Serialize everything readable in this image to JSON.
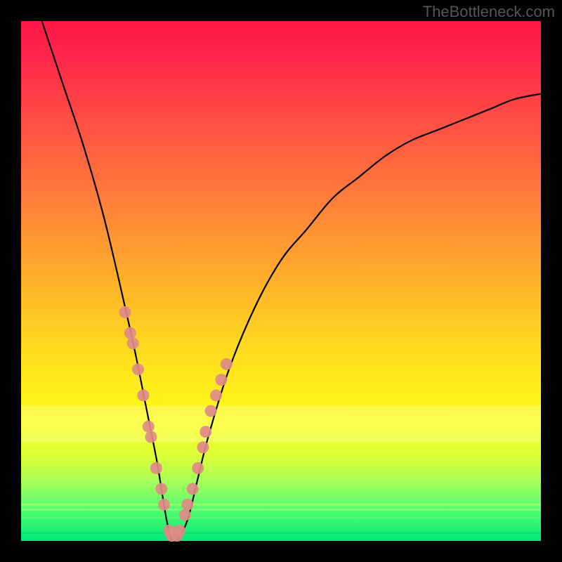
{
  "attribution": "TheBottleneck.com",
  "chart_data": {
    "type": "line",
    "title": "",
    "xlabel": "",
    "ylabel": "",
    "xlim": [
      0,
      100
    ],
    "ylim": [
      0,
      100
    ],
    "legend": false,
    "grid": false,
    "series": [
      {
        "name": "curve",
        "color": "#000000",
        "x": [
          4,
          8,
          12,
          16,
          20,
          22,
          24,
          26,
          27,
          28,
          29,
          30,
          32,
          34,
          36,
          40,
          45,
          50,
          55,
          60,
          65,
          70,
          75,
          80,
          85,
          90,
          95,
          100
        ],
        "y": [
          100,
          88,
          76,
          62,
          45,
          36,
          26,
          16,
          10,
          4,
          0,
          0,
          4,
          12,
          20,
          33,
          45,
          54,
          60,
          66,
          70,
          74,
          77,
          79,
          81,
          83,
          85,
          86
        ]
      },
      {
        "name": "markers-left",
        "color": "#e08a88",
        "x": [
          20.0,
          21.0,
          21.5,
          22.5,
          23.5,
          24.5,
          25.0,
          26.0,
          27.0,
          27.5,
          28.5,
          29.0
        ],
        "y": [
          44,
          40,
          38,
          33,
          28,
          22,
          20,
          14,
          10,
          7,
          2,
          1
        ]
      },
      {
        "name": "markers-right",
        "color": "#e08a88",
        "x": [
          30.0,
          30.5,
          31.5,
          32.0,
          33.0,
          34.0,
          35.0,
          35.5,
          36.5,
          37.5,
          38.5,
          39.5
        ],
        "y": [
          1,
          2,
          5,
          7,
          10,
          14,
          18,
          21,
          25,
          28,
          31,
          34
        ]
      }
    ],
    "bands": [
      {
        "name": "pale-band",
        "y_from": 19,
        "y_to": 26,
        "color": "rgba(255,255,180,0.35)"
      }
    ],
    "bottom_stripes": [
      {
        "y": 1.5,
        "color": "#00e070"
      },
      {
        "y": 3.0,
        "color": "#40e870"
      },
      {
        "y": 4.5,
        "color": "#70f870"
      },
      {
        "y": 6.0,
        "color": "#a0ff70"
      },
      {
        "y": 7.0,
        "color": "#c8ff60"
      }
    ]
  }
}
